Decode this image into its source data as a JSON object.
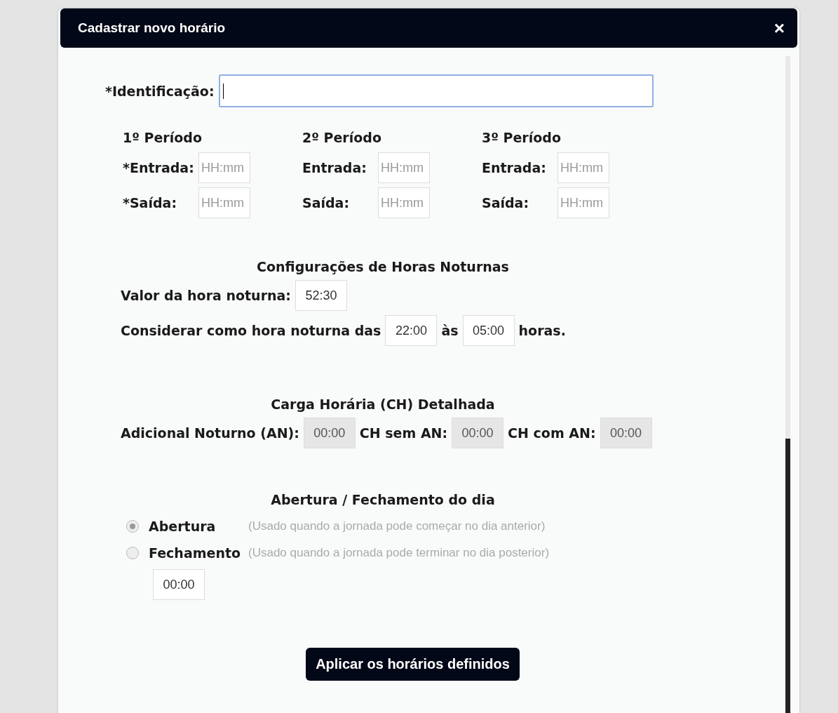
{
  "dialog": {
    "title": "Cadastrar novo horário",
    "close": "×"
  },
  "identification": {
    "label": "*Identificação:",
    "focused": true
  },
  "periods": [
    {
      "title": "1º Período",
      "fields": [
        {
          "label": "*Entrada:",
          "placeholder": "HH:mm"
        },
        {
          "label": "*Saída:",
          "placeholder": "HH:mm"
        }
      ]
    },
    {
      "title": "2º Período",
      "fields": [
        {
          "label": "Entrada:",
          "placeholder": "HH:mm"
        },
        {
          "label": "Saída:",
          "placeholder": "HH:mm"
        }
      ]
    },
    {
      "title": "3º Período",
      "fields": [
        {
          "label": "Entrada:",
          "placeholder": "HH:mm"
        },
        {
          "label": "Saída:",
          "placeholder": "HH:mm"
        }
      ]
    }
  ],
  "night_hours": {
    "title": "Configurações de Horas Noturnas",
    "value_label": "Valor da hora noturna:",
    "value": "52:30",
    "range_label": "Considerar como hora noturna das",
    "from": "22:00",
    "between": "às",
    "to": "05:00",
    "suffix": "horas."
  },
  "workload": {
    "title": "Carga Horária (CH) Detalhada",
    "fields": [
      {
        "label": "Adicional Noturno (AN):",
        "value": "00:00",
        "disabled": true
      },
      {
        "label": "CH sem AN:",
        "value": "00:00",
        "disabled": true
      },
      {
        "label": "CH com AN:",
        "value": "00:00",
        "disabled": true
      }
    ]
  },
  "day_boundary": {
    "title": "Abertura / Fechamento do dia",
    "options": [
      {
        "label": "Abertura",
        "hint": "(Usado quando a jornada pode começar no dia anterior)",
        "selected": true
      },
      {
        "label": "Fechamento",
        "hint": "(Usado quando a jornada pode terminar no dia posterior)",
        "selected": false
      }
    ],
    "time": "00:00"
  },
  "apply_button": "Aplicar os horários definidos"
}
